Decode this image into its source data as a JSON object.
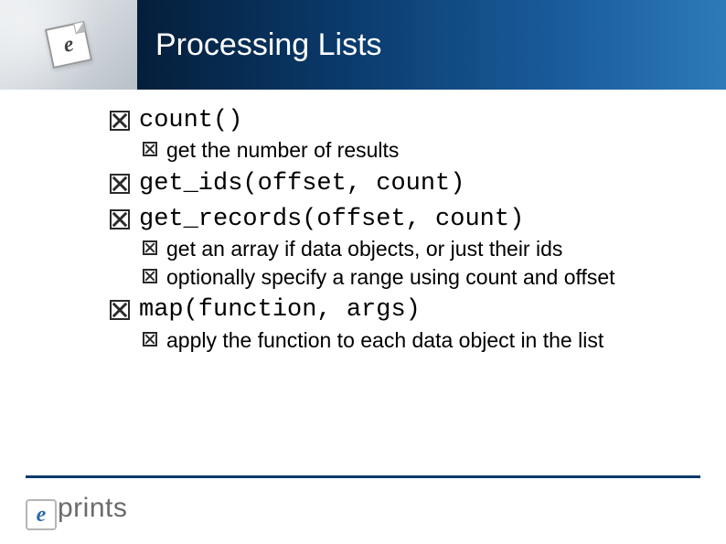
{
  "title": "Processing Lists",
  "corner_icon_letter": "e",
  "items": [
    {
      "level": 1,
      "kind": "code",
      "text": "count()"
    },
    {
      "level": 2,
      "kind": "body",
      "text": "get the number of results"
    },
    {
      "level": 1,
      "kind": "code",
      "text": "get_ids(offset, count)"
    },
    {
      "level": 1,
      "kind": "code",
      "text": "get_records(offset, count)"
    },
    {
      "level": 2,
      "kind": "body",
      "text": "get an array if data objects, or just their ids"
    },
    {
      "level": 2,
      "kind": "body",
      "text": "optionally specify a range using count and offset"
    },
    {
      "level": 1,
      "kind": "code",
      "text": "map(function, args)"
    },
    {
      "level": 2,
      "kind": "body",
      "text": "apply the function to each data object in the list"
    }
  ],
  "footer": {
    "logo_e": "e",
    "logo_rest": "prints"
  }
}
